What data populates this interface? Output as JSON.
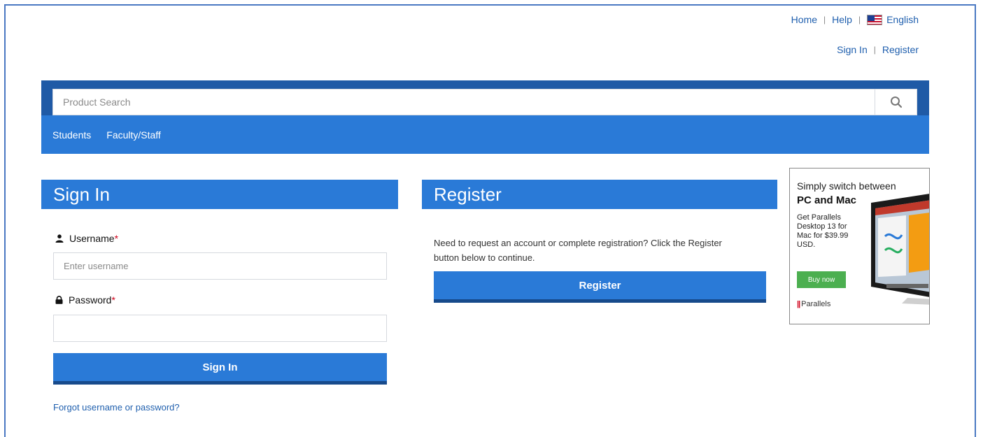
{
  "header": {
    "links": {
      "home": "Home",
      "help": "Help",
      "language": "English"
    },
    "account": {
      "sign_in": "Sign In",
      "register": "Register"
    }
  },
  "search": {
    "placeholder": "Product Search",
    "icon": "search-icon"
  },
  "nav": {
    "items": [
      "Students",
      "Faculty/Staff"
    ]
  },
  "signin": {
    "title": "Sign In",
    "username_label": "Username",
    "username_placeholder": "Enter username",
    "password_label": "Password",
    "required_mark": "*",
    "button": "Sign In",
    "forgot": "Forgot username or password?"
  },
  "register": {
    "title": "Register",
    "description": "Need to request an account or complete registration? Click the Register button below to continue.",
    "button": "Register"
  },
  "ad": {
    "line1": "Simply switch between",
    "line2": "PC and Mac",
    "body": "Get Parallels Desktop 13 for Mac for $39.99 USD.",
    "button": "Buy now",
    "brand_mark": "||",
    "brand": "Parallels"
  },
  "colors": {
    "primary": "#2a7ad7",
    "dark": "#1f5aa6",
    "link": "#1f5fae",
    "required": "#d0021b",
    "ad_button": "#4caf50"
  }
}
